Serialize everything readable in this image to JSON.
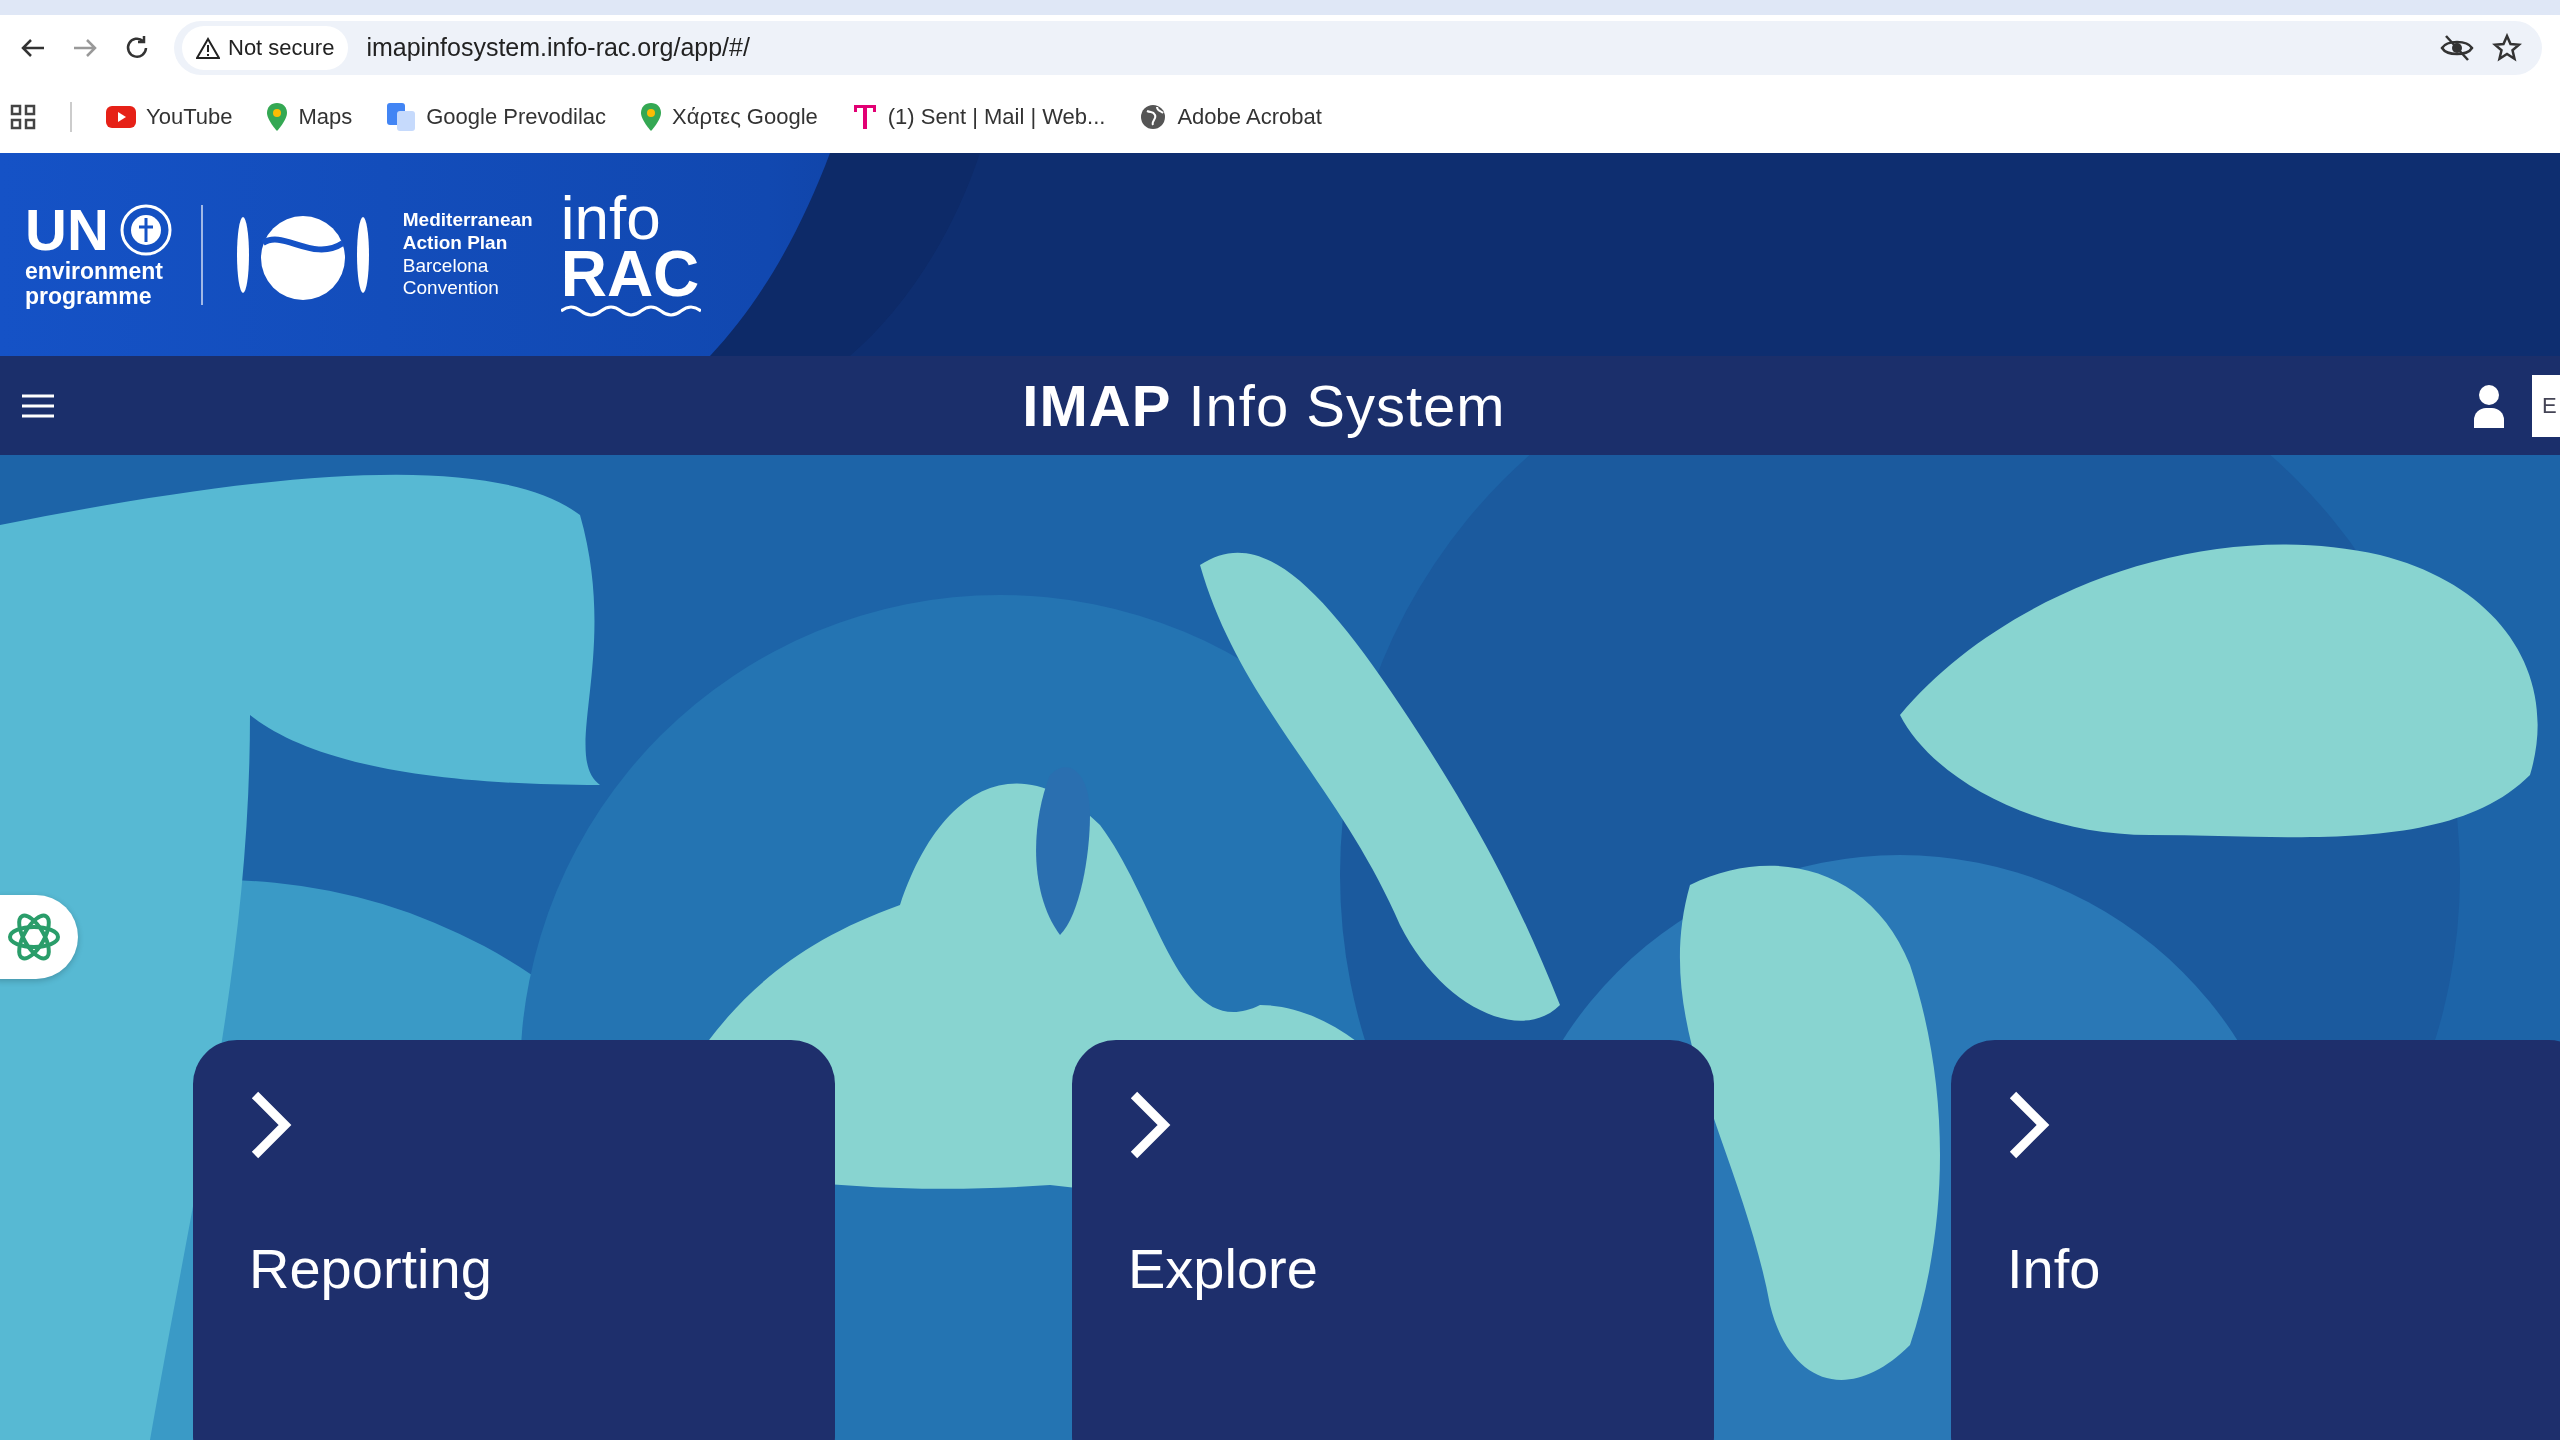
{
  "browser": {
    "security_label": "Not secure",
    "url": "imapinfosystem.info-rac.org/app/#/",
    "bookmarks": [
      {
        "kind": "video",
        "label": "YouTube"
      },
      {
        "kind": "pin",
        "label": "Maps"
      },
      {
        "kind": "translate",
        "label": "Google Prevodilac"
      },
      {
        "kind": "pin",
        "label": "Χάρτες Google"
      },
      {
        "kind": "telekom",
        "label": "(1) Sent | Mail | Web..."
      },
      {
        "kind": "globe",
        "label": "Adobe Acrobat"
      }
    ]
  },
  "header": {
    "un_logo": {
      "abbr": "UN",
      "text": [
        "environment",
        "programme"
      ]
    },
    "map_logo": {
      "lines": [
        {
          "text": "Mediterranean",
          "bold": true
        },
        {
          "text": "Action Plan",
          "bold": true
        },
        {
          "text": "Barcelona",
          "bold": false
        },
        {
          "text": "Convention",
          "bold": false
        }
      ]
    },
    "inforac_logo": {
      "top": "info",
      "bottom": "RAC"
    }
  },
  "nav": {
    "title": "**IMAP** Info System",
    "language": "E"
  },
  "cards": [
    {
      "label": "Reporting"
    },
    {
      "label": "Explore"
    },
    {
      "label": "Info"
    }
  ]
}
